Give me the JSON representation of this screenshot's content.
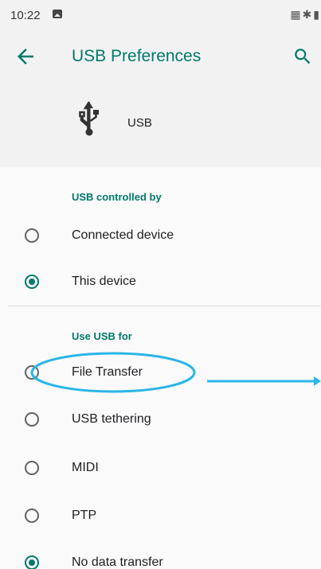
{
  "status_bar": {
    "time": "10:22",
    "icons": [
      "image-notification-icon",
      "signal-icon",
      "bluetooth-icon",
      "battery-icon"
    ]
  },
  "app_bar": {
    "title": "USB Preferences",
    "back_icon": "arrow-back-icon",
    "search_icon": "search-icon"
  },
  "usb_header": {
    "icon": "usb-icon",
    "label": "USB"
  },
  "controlled_by": {
    "title": "USB controlled by",
    "options": [
      {
        "label": "Connected device",
        "checked": false
      },
      {
        "label": "This device",
        "checked": true
      }
    ]
  },
  "use_usb_for": {
    "title": "Use USB for",
    "options": [
      {
        "label": "File Transfer",
        "checked": false
      },
      {
        "label": "USB tethering",
        "checked": false
      },
      {
        "label": "MIDI",
        "checked": false
      },
      {
        "label": "PTP",
        "checked": false
      },
      {
        "label": "No data transfer",
        "checked": true
      }
    ]
  },
  "annotation": {
    "target": "File Transfer",
    "color": "#29b6e8"
  },
  "colors": {
    "accent": "#00796b",
    "background": "#f2f2f2",
    "annotation": "#29b6e8"
  }
}
